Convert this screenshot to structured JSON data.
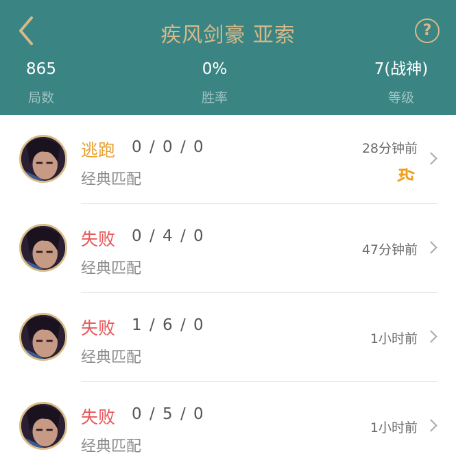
{
  "header": {
    "title": "疾风剑豪 亚索",
    "back_icon": "chevron-left-icon",
    "help_icon": "question-circle-icon",
    "help_glyph": "?",
    "colors": {
      "background": "#3a8583",
      "accent": "#d8b98a"
    }
  },
  "stats": [
    {
      "value": "865",
      "label": "局数"
    },
    {
      "value": "0%",
      "label": "胜率"
    },
    {
      "value": "7(战神)",
      "label": "等级"
    }
  ],
  "matches": [
    {
      "result": "逃跑",
      "result_color": "#e8a030",
      "kda": "0 / 0 / 0",
      "mode": "经典匹配",
      "time": "28分钟前",
      "badge_icon": "escape-badge-icon"
    },
    {
      "result": "失败",
      "result_color": "#e8575a",
      "kda": "0 / 4 / 0",
      "mode": "经典匹配",
      "time": "47分钟前"
    },
    {
      "result": "失败",
      "result_color": "#e8575a",
      "kda": "1 / 6 / 0",
      "mode": "经典匹配",
      "time": "1小时前"
    },
    {
      "result": "失败",
      "result_color": "#e8575a",
      "kda": "0 / 5 / 0",
      "mode": "经典匹配",
      "time": "1小时前"
    }
  ]
}
